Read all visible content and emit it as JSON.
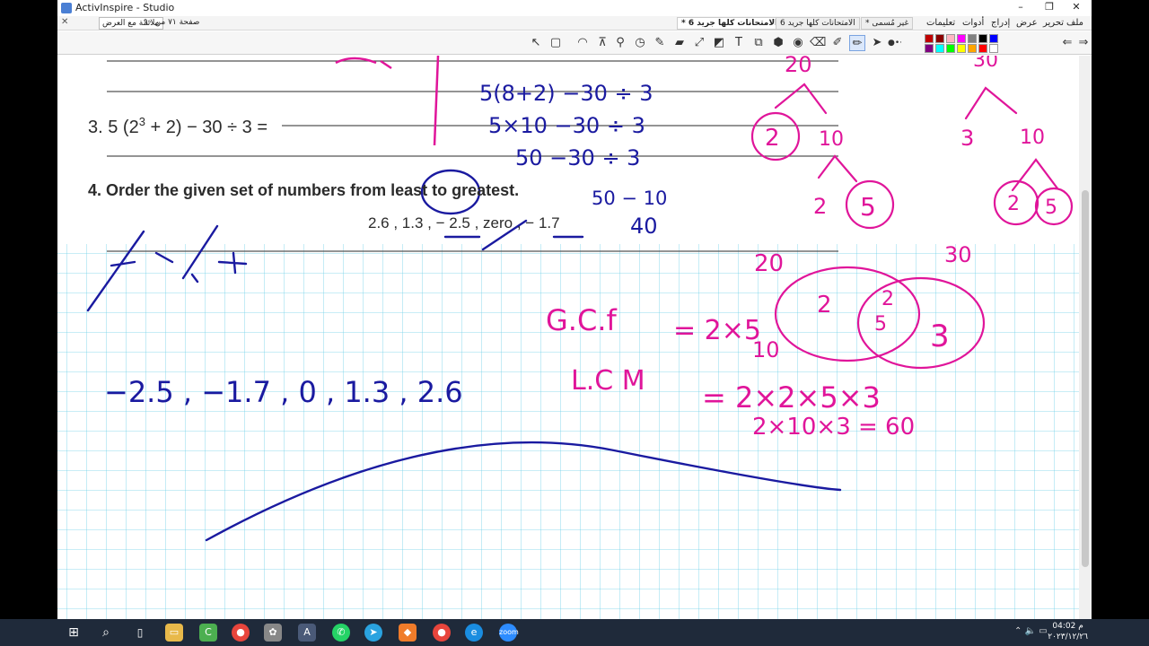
{
  "window": {
    "title": "ActivInspire - Studio",
    "min": "–",
    "max": "❐",
    "close": "✕"
  },
  "menubar": {
    "back": "✕",
    "page_mode": "ملائمة مع العرض",
    "page_count": "صفحة ٧١ من ٩٠",
    "tabs": [
      {
        "label": "الامتحانات كلها  جريد 6 *",
        "active": true
      },
      {
        "label": "الامتحانات كلها  جريد 6",
        "active": false
      },
      {
        "label": "غير مُسمى *",
        "active": false
      }
    ],
    "menus": [
      "ملف",
      "تحرير",
      "عرض",
      "إدراج",
      "أدوات",
      "تعليمات"
    ]
  },
  "toolbar": {
    "icons": [
      "select-icon",
      "marquee-icon",
      "resize-icon",
      "spotlight-icon",
      "compass-icon",
      "protractor-icon",
      "clock-icon",
      "magic-ink-icon",
      "highlighter-icon",
      "connector-icon",
      "shape-icon",
      "text-icon",
      "stamp-icon",
      "fill-icon",
      "camera-icon",
      "eraser-icon",
      "marker-icon",
      "pen-icon"
    ],
    "colors": [
      "#c00000",
      "#8b0000",
      "#ffb6c1",
      "#ff00ff",
      "#808080",
      "#000000",
      "#0000ff",
      "#800080",
      "#00ffff",
      "#00ff00",
      "#ffff00",
      "#ffa500",
      "#ff0000",
      "#ffffff"
    ]
  },
  "worksheet": {
    "q3": "3. 5 (2",
    "q3_exp": "3",
    "q3_rest": " + 2) − 30 ÷ 3 =",
    "q4": "4. Order the given set of numbers from least to greatest.",
    "q4_set": "2.6 , 1.3 , − 2.5 , zero , − 1.7"
  },
  "handwriting": {
    "step1": "5(8+2) −30 ÷ 3",
    "step2": "5×10 −30 ÷ 3",
    "step3": "50 −30 ÷ 3",
    "step4": "50 − 10",
    "step5": "40",
    "answer": "−2.5 , −1.7 , 0 , 1.3 , 2.6",
    "gcf_label": "G.C.f",
    "gcf_value": "= 2×5",
    "gcf_result": "10",
    "lcm_label": "L.C M",
    "lcm_value": "= 2×2×5×3",
    "lcm_value2": "2×10×3 = 60",
    "t1_top": "20",
    "t1_l": "2",
    "t1_r": "10",
    "t1_rl": "2",
    "t1_rr": "5",
    "t2_top": "30",
    "t2_l": "3",
    "t2_r": "10",
    "t2_rl": "2",
    "t2_rr": "5",
    "venn_20": "20",
    "venn_30": "30",
    "venn_a": "2",
    "venn_mid": "2",
    "venn_mid2": "5",
    "venn_b": "3"
  },
  "taskbar": {
    "apps": [
      "file-explorer",
      "camtasia",
      "chrome",
      "paint",
      "activinspire",
      "whatsapp",
      "telegram",
      "app-orange",
      "chrome-2",
      "edge",
      "zoom"
    ],
    "time": "04:02 م",
    "date": "٢٠٢٣/١٢/٢٦"
  }
}
